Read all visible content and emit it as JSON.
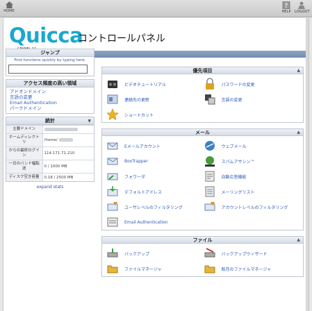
{
  "toolbar": {
    "home_label": "HOME",
    "help_label": "HELP",
    "logout_label": "LOGOUT"
  },
  "header": {
    "logo_text": "Quicca",
    "title": "コントロールパネル",
    "theme_label": "CPANEL 11"
  },
  "jump": {
    "title": "ジャンプ",
    "hint": "Find functions quickly by typing here."
  },
  "frequent": {
    "title": "アクセス頻度の高い領域",
    "items": [
      "アドオンドメイン",
      "言語の変更",
      "Email Authentication",
      "パークドメイン"
    ]
  },
  "stats": {
    "title": "統計",
    "rows": [
      {
        "key": "主要ドメイン",
        "value": ""
      },
      {
        "key": "ホームディレクトリ",
        "value": "/home/"
      },
      {
        "key": "からの最終ログイン",
        "value": "114.171.71.210"
      },
      {
        "key": "一日のバンド幅転送",
        "value": "0 / 1000 MB"
      },
      {
        "key": "ディスク空き容量",
        "value": "0.18 / 2500 MB"
      }
    ],
    "expand_label": "expand stats"
  },
  "sections": {
    "priority": {
      "title": "優先項目",
      "items": [
        "ビデオチュートリアル",
        "パスワードの変更",
        "連絡先の更新",
        "言語の変更",
        "ショートカット"
      ]
    },
    "mail": {
      "title": "メール",
      "items": [
        "Eメールアカウント",
        "ウェブメール",
        "BoxTrapper",
        "スパムアサシン™",
        "フォワーダ",
        "自動応答機能",
        "デフォルトアドレス",
        "メーリングリスト",
        "ユーザレベルのフィルタリング",
        "アカウントレベルのフィルタリング",
        "Email Authentication"
      ]
    },
    "files": {
      "title": "ファイル",
      "items": [
        "バックアップ",
        "バックアップウィザード",
        "ファイルマネージャ",
        "既存のファイルマネージャ"
      ]
    }
  },
  "colors": {
    "accent": "#1aa8cf",
    "link": "#2d5bb5",
    "header_bg": "#d6dde8"
  }
}
